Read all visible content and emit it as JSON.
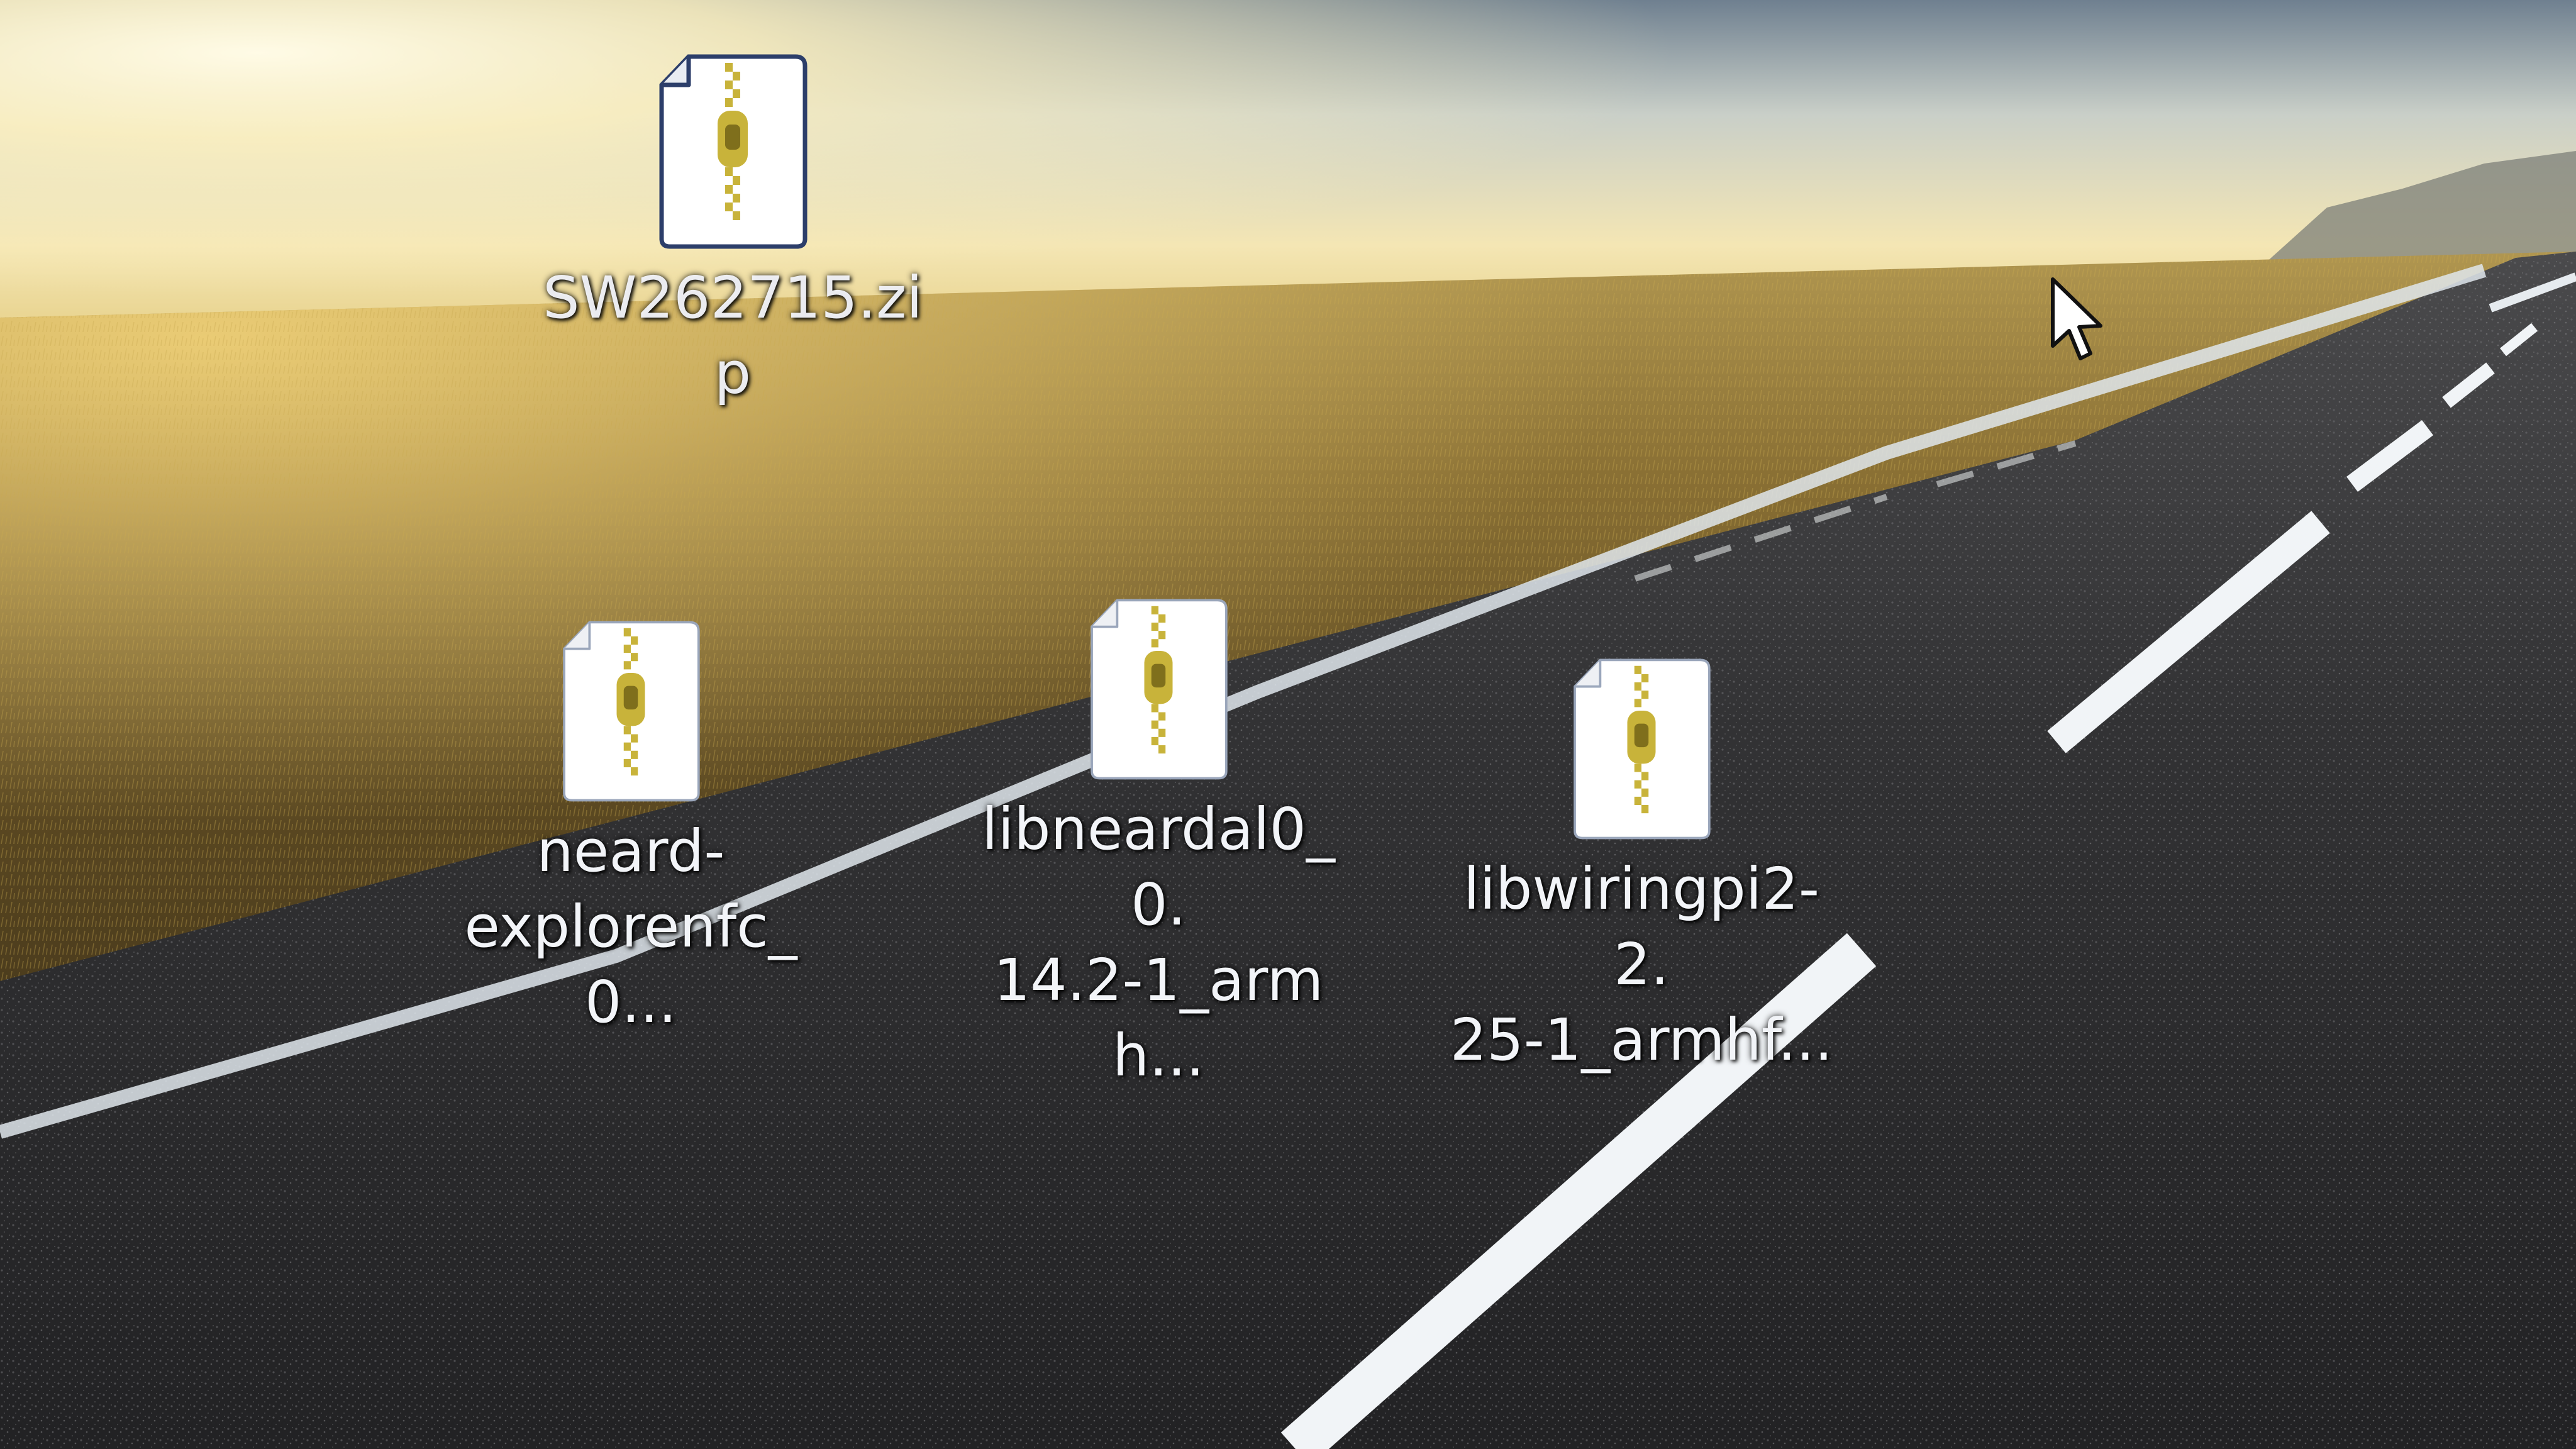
{
  "desktop": {
    "wallpaper": {
      "description_colors": {
        "sky_glow": "#fff6d2",
        "horizon": "#d9c06a",
        "field": "#6f5a28",
        "road": "#2a2a2c",
        "lane_marking": "#eef2f5"
      }
    },
    "icons": [
      {
        "label": "SW262715.zi\np",
        "icon": "zip-archive-icon"
      },
      {
        "label": "neard-\nexplorenfc_0...",
        "icon": "zip-archive-icon"
      },
      {
        "label": "libneardal0_0.\n14.2-1_armh...",
        "icon": "zip-archive-icon"
      },
      {
        "label": "libwiringpi2-2.\n25-1_armhf...",
        "icon": "zip-archive-icon"
      }
    ],
    "pointer": {
      "icon": "mouse-pointer-icon"
    }
  },
  "colors": {
    "icon_paper": "#ffffff",
    "icon_outline": "#2c3e6a",
    "zipper": "#c8b33a",
    "label_text": "#f2f4f8"
  }
}
